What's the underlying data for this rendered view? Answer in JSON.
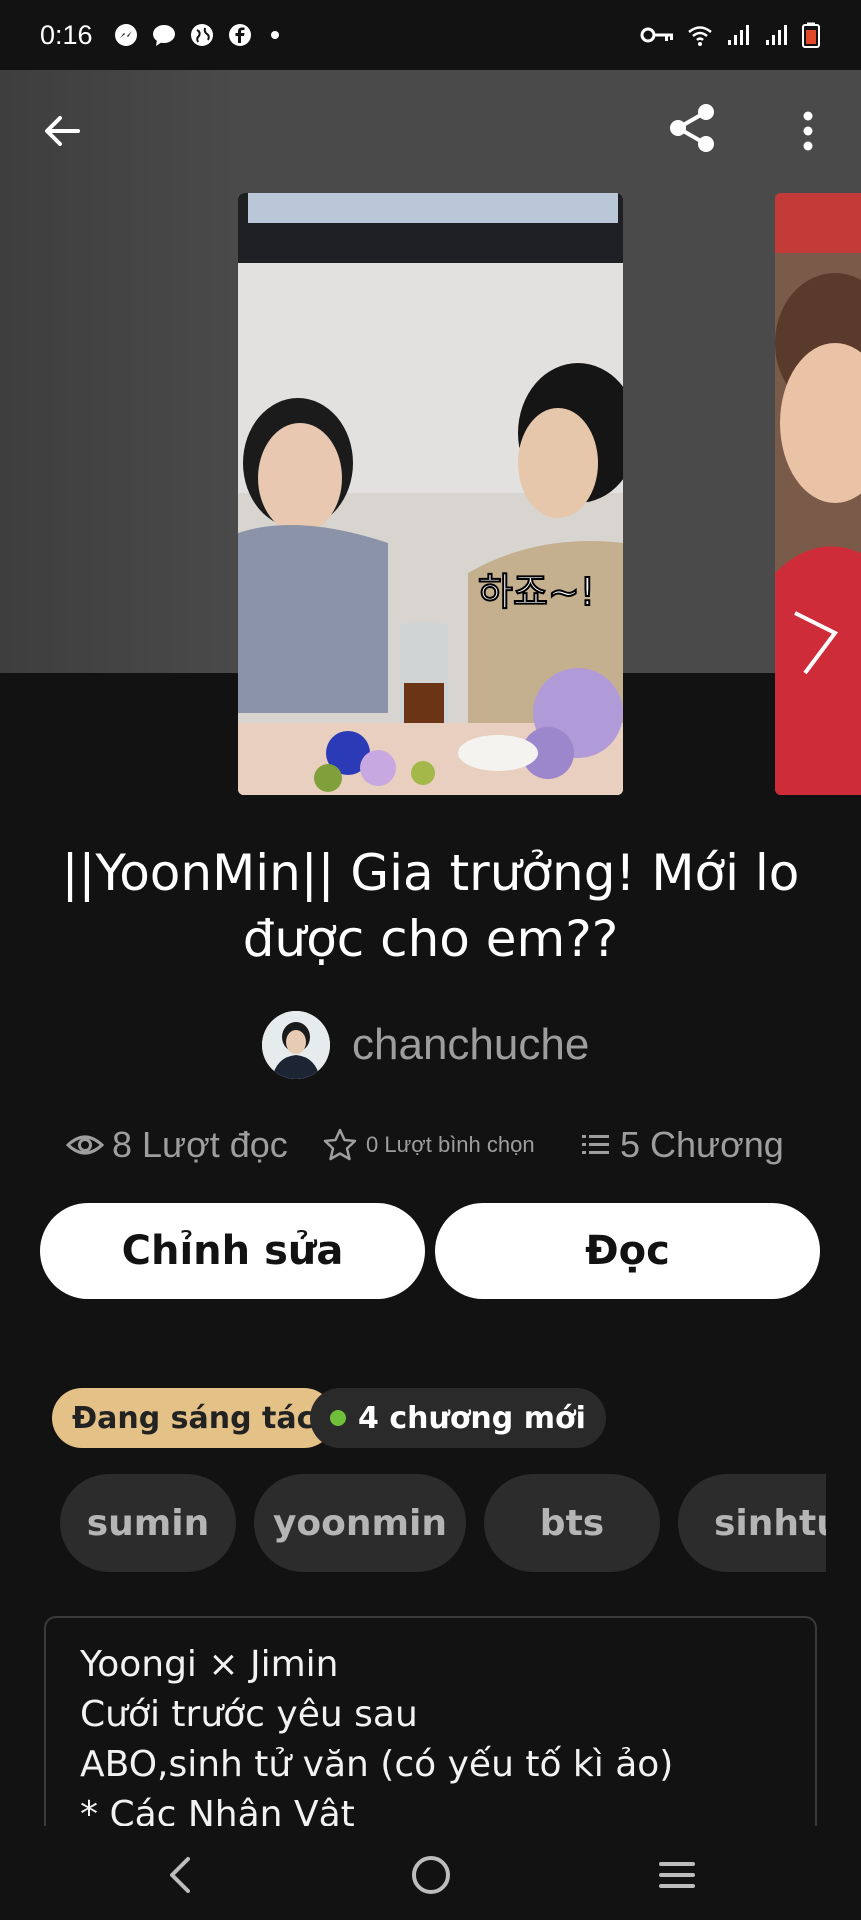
{
  "status_bar": {
    "time": "0:16",
    "left_icons": [
      "messenger-icon",
      "chat-icon",
      "globe-icon",
      "facebook-icon",
      "dot-icon"
    ],
    "right_icons": [
      "key-icon",
      "wifi-icon",
      "signal-icon",
      "signal-icon",
      "battery-icon"
    ]
  },
  "header": {
    "back_icon": "arrow-left-icon",
    "share_icon": "share-icon",
    "menu_icon": "more-vertical-icon"
  },
  "cover": {
    "caption_text": "하죠~!"
  },
  "story": {
    "title": "||YoonMin|| Gia trưởng! Mới lo được cho em??",
    "author": "chanchuche"
  },
  "stats": {
    "reads": "8 Lượt đọc",
    "votes": "0 Lượt bình chọn",
    "chapters": "5 Chương"
  },
  "actions": {
    "edit_label": "Chỉnh sửa",
    "read_label": "Đọc"
  },
  "badges": {
    "status": "Đang sáng tác",
    "new_chapters": "4 chương mới"
  },
  "tags": [
    "sumin",
    "yoonmin",
    "bts",
    "sinhtuv"
  ],
  "description": {
    "lines": [
      "Yoongi × Jimin",
      "Cưới trước yêu sau",
      "ABO,sinh tử văn (có yếu tố kì ảo)",
      "* Các Nhân Vật"
    ]
  },
  "colors": {
    "background": "#121212",
    "status_badge": "#e3c187",
    "new_dot": "#6fbf3a",
    "tag_bg": "#2c2c2c"
  }
}
